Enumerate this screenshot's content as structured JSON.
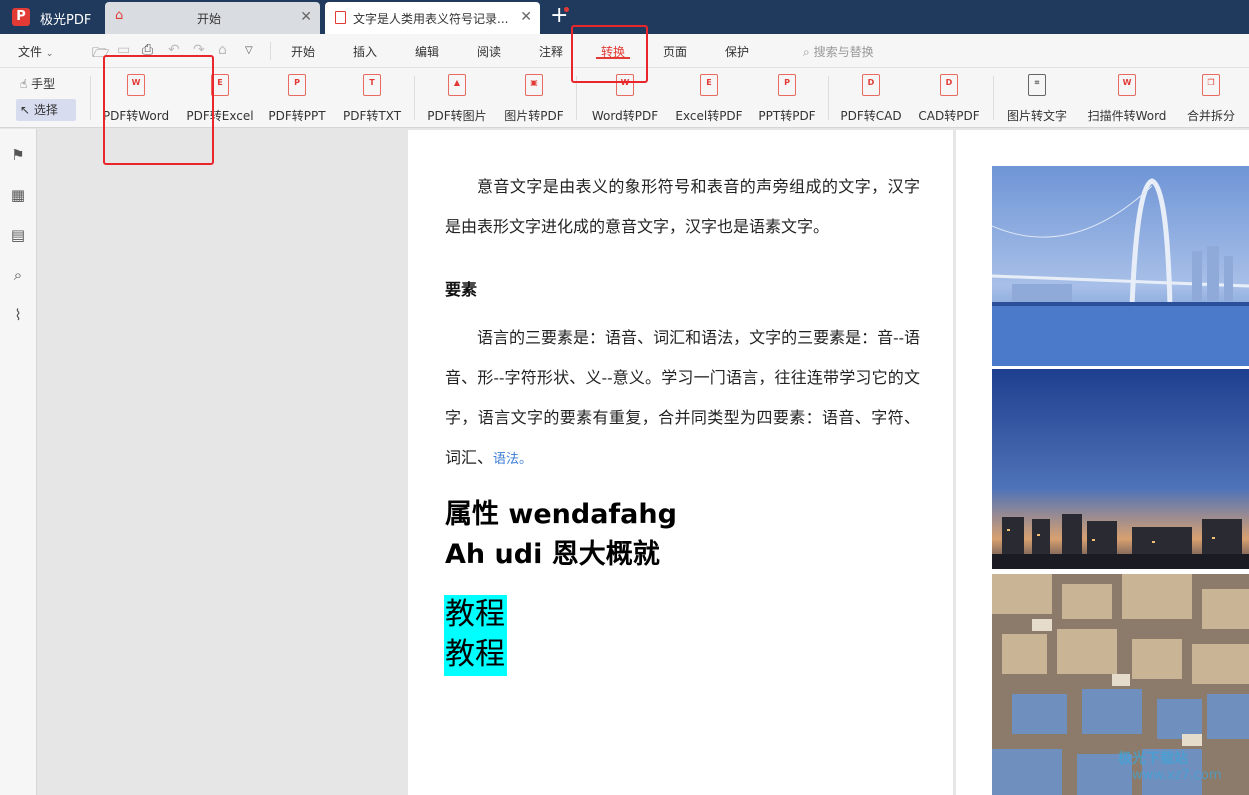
{
  "app": {
    "name": "极光PDF",
    "logo": "P"
  },
  "tabs": [
    {
      "label": "开始",
      "icon": "home-icon"
    },
    {
      "label": "文字是人类用表义符号记录...",
      "icon": "pdf-doc-icon"
    }
  ],
  "menu": {
    "file": "文件",
    "items": [
      "开始",
      "插入",
      "编辑",
      "阅读",
      "注释",
      "转换",
      "页面",
      "保护"
    ],
    "active": "转换",
    "search_placeholder": "搜索与替换"
  },
  "modes": {
    "hand": "手型",
    "select": "选择"
  },
  "ribbon": [
    {
      "label": "PDF转Word",
      "glyph": "W"
    },
    {
      "label": "PDF转Excel",
      "glyph": "E"
    },
    {
      "label": "PDF转PPT",
      "glyph": "P"
    },
    {
      "label": "PDF转TXT",
      "glyph": "T"
    },
    {
      "label": "PDF转图片",
      "glyph": "▲"
    },
    {
      "label": "图片转PDF",
      "glyph": "▣"
    },
    {
      "label": "Word转PDF",
      "glyph": "W"
    },
    {
      "label": "Excel转PDF",
      "glyph": "E"
    },
    {
      "label": "PPT转PDF",
      "glyph": "P"
    },
    {
      "label": "PDF转CAD",
      "glyph": "D"
    },
    {
      "label": "CAD转PDF",
      "glyph": "D"
    },
    {
      "label": "图片转文字",
      "glyph": "⌗"
    },
    {
      "label": "扫描件转Word",
      "glyph": "W"
    },
    {
      "label": "合并拆分",
      "glyph": "❐"
    }
  ],
  "document": {
    "para1": "意音文字是由表义的象形符号和表音的声旁组成的文字，汉字是由表形文字进化成的意音文字，汉字也是语素文字。",
    "section_title": "要素",
    "para2": "语言的三要素是：语音、词汇和语法，文字的三要素是：音--语音、形--字符形状、义--意义。学习一门语言，往往连带学习它的文字，语言文字的要素有重复，合并同类型为四要素：语音、字符、词汇、",
    "para2_link": "语法。",
    "big_line1": "属性 wendafahg",
    "big_line2": "Ah udi 恩大概就",
    "hl_line1": "教程",
    "hl_line2": "教程"
  },
  "watermark": {
    "line1": "极光下载站",
    "line2": "www.xz7.com"
  },
  "colors": {
    "titlebar": "#1f3a5c",
    "accent": "#e23b35",
    "highlight": "#00ffff",
    "annotation": "#e8262b"
  }
}
